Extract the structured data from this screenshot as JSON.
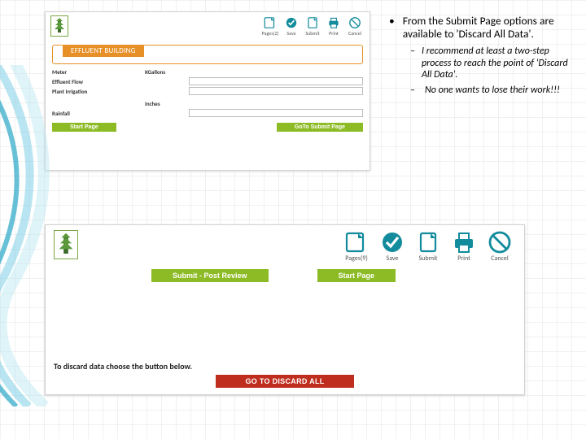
{
  "notes": {
    "bullet": "•",
    "main": "From the Submit Page options are available to 'Discard All Data'.",
    "sub1": "I recommend at least a two-step process to reach the point of 'Discard All Data'.",
    "sub2": "No one wants to lose their work!!!",
    "dash": "–"
  },
  "panel_top": {
    "toolbar": {
      "pages": "Pages(2)",
      "save": "Save",
      "submit": "Submit",
      "print": "Print",
      "cancel": "Cancel"
    },
    "section_header": "EFFLUENT BUILDING",
    "fields": {
      "meter": "Meter",
      "effluent_flow": "Effluent Flow",
      "plant_irrigation": "Plant Irrigation",
      "rainfall": "Rainfall"
    },
    "units": {
      "kgallons": "KGallons",
      "inches": "Inches"
    },
    "buttons": {
      "start": "Start Page",
      "goto_submit": "GoTo Submit Page"
    }
  },
  "panel_bot": {
    "toolbar": {
      "pages": "Pages(9)",
      "save": "Save",
      "submit": "Submit",
      "print": "Print",
      "cancel": "Cancel"
    },
    "buttons": {
      "submit_post": "Submit - Post Review",
      "start": "Start Page"
    },
    "discard_text": "To discard data choose the button below.",
    "discard_btn": "GO TO DISCARD ALL"
  },
  "colors": {
    "green": "#8dbb26",
    "orange": "#e89028",
    "teal": "#128b9c",
    "red": "#bf2d1e"
  }
}
